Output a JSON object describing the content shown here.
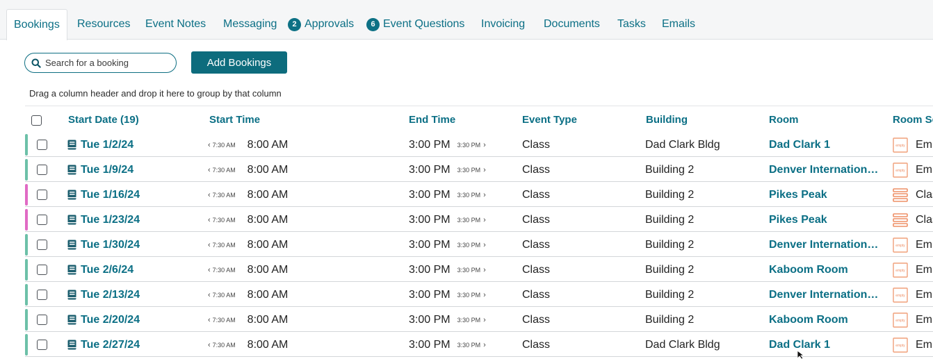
{
  "tabs": [
    {
      "label": "Bookings",
      "active": true
    },
    {
      "label": "Resources"
    },
    {
      "label": "Event Notes"
    },
    {
      "label": "Messaging"
    },
    {
      "label": "Approvals",
      "badge": "2"
    },
    {
      "label": "Event Questions",
      "badge": "6"
    },
    {
      "label": "Invoicing"
    },
    {
      "label": "Documents"
    },
    {
      "label": "Tasks"
    },
    {
      "label": "Emails"
    }
  ],
  "toolbar": {
    "search_placeholder": "Search for a booking",
    "add_bookings_label": "Add Bookings"
  },
  "group_hint": "Drag a column header and drop it here to group by that column",
  "columns": {
    "start_date": "Start Date (19)",
    "start_time": "Start Time",
    "end_time": "End Time",
    "event_type": "Event Type",
    "building": "Building",
    "room": "Room",
    "room_setup": "Room Se"
  },
  "status_colors": {
    "green": "#6cc0a8",
    "pink": "#e06ac4"
  },
  "icons": {
    "date": "book-icon",
    "setup_empty": "empty-setup-icon",
    "setup_class": "classroom-setup-icon"
  },
  "rows": [
    {
      "status": "green",
      "date": "Tue 1/2/24",
      "prev_start": "7:30 AM",
      "start": "8:00 AM",
      "end": "3:00 PM",
      "next_end": "3:30 PM",
      "event_type": "Class",
      "building": "Dad Clark Bldg",
      "room": "Dad Clark 1",
      "setup_icon": "empty",
      "setup": "Emp"
    },
    {
      "status": "green",
      "date": "Tue 1/9/24",
      "prev_start": "7:30 AM",
      "start": "8:00 AM",
      "end": "3:00 PM",
      "next_end": "3:30 PM",
      "event_type": "Class",
      "building": "Building 2",
      "room": "Denver Internation…",
      "setup_icon": "empty",
      "setup": "Emp"
    },
    {
      "status": "pink",
      "date": "Tue 1/16/24",
      "prev_start": "7:30 AM",
      "start": "8:00 AM",
      "end": "3:00 PM",
      "next_end": "3:30 PM",
      "event_type": "Class",
      "building": "Building 2",
      "room": "Pikes Peak",
      "setup_icon": "class",
      "setup": "Clas"
    },
    {
      "status": "pink",
      "date": "Tue 1/23/24",
      "prev_start": "7:30 AM",
      "start": "8:00 AM",
      "end": "3:00 PM",
      "next_end": "3:30 PM",
      "event_type": "Class",
      "building": "Building 2",
      "room": "Pikes Peak",
      "setup_icon": "class",
      "setup": "Clas"
    },
    {
      "status": "green",
      "date": "Tue 1/30/24",
      "prev_start": "7:30 AM",
      "start": "8:00 AM",
      "end": "3:00 PM",
      "next_end": "3:30 PM",
      "event_type": "Class",
      "building": "Building 2",
      "room": "Denver Internation…",
      "setup_icon": "empty",
      "setup": "Emp"
    },
    {
      "status": "green",
      "date": "Tue 2/6/24",
      "prev_start": "7:30 AM",
      "start": "8:00 AM",
      "end": "3:00 PM",
      "next_end": "3:30 PM",
      "event_type": "Class",
      "building": "Building 2",
      "room": "Kaboom Room",
      "setup_icon": "empty",
      "setup": "Emp"
    },
    {
      "status": "green",
      "date": "Tue 2/13/24",
      "prev_start": "7:30 AM",
      "start": "8:00 AM",
      "end": "3:00 PM",
      "next_end": "3:30 PM",
      "event_type": "Class",
      "building": "Building 2",
      "room": "Denver Internation…",
      "setup_icon": "empty",
      "setup": "Emp"
    },
    {
      "status": "green",
      "date": "Tue 2/20/24",
      "prev_start": "7:30 AM",
      "start": "8:00 AM",
      "end": "3:00 PM",
      "next_end": "3:30 PM",
      "event_type": "Class",
      "building": "Building 2",
      "room": "Kaboom Room",
      "setup_icon": "empty",
      "setup": "Emp"
    },
    {
      "status": "green",
      "date": "Tue 2/27/24",
      "prev_start": "7:30 AM",
      "start": "8:00 AM",
      "end": "3:00 PM",
      "next_end": "3:30 PM",
      "event_type": "Class",
      "building": "Dad Clark Bldg",
      "room": "Dad Clark 1",
      "setup_icon": "empty",
      "setup": "Emp"
    }
  ]
}
